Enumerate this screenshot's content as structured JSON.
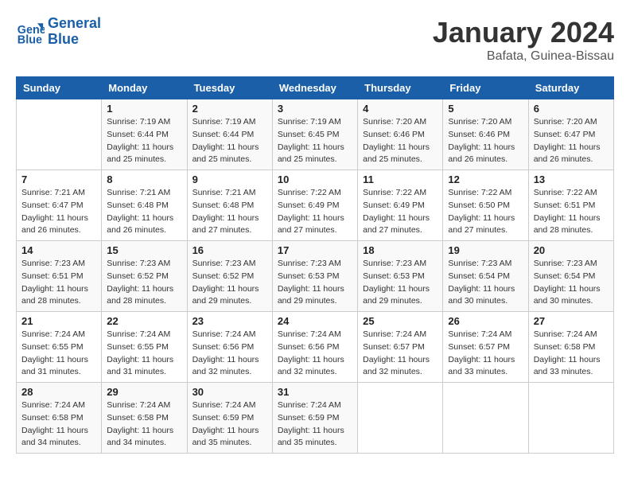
{
  "header": {
    "logo_line1": "General",
    "logo_line2": "Blue",
    "month": "January 2024",
    "location": "Bafata, Guinea-Bissau"
  },
  "weekdays": [
    "Sunday",
    "Monday",
    "Tuesday",
    "Wednesday",
    "Thursday",
    "Friday",
    "Saturday"
  ],
  "weeks": [
    [
      {
        "day": "",
        "detail": ""
      },
      {
        "day": "1",
        "detail": "Sunrise: 7:19 AM\nSunset: 6:44 PM\nDaylight: 11 hours\nand 25 minutes."
      },
      {
        "day": "2",
        "detail": "Sunrise: 7:19 AM\nSunset: 6:44 PM\nDaylight: 11 hours\nand 25 minutes."
      },
      {
        "day": "3",
        "detail": "Sunrise: 7:19 AM\nSunset: 6:45 PM\nDaylight: 11 hours\nand 25 minutes."
      },
      {
        "day": "4",
        "detail": "Sunrise: 7:20 AM\nSunset: 6:46 PM\nDaylight: 11 hours\nand 25 minutes."
      },
      {
        "day": "5",
        "detail": "Sunrise: 7:20 AM\nSunset: 6:46 PM\nDaylight: 11 hours\nand 26 minutes."
      },
      {
        "day": "6",
        "detail": "Sunrise: 7:20 AM\nSunset: 6:47 PM\nDaylight: 11 hours\nand 26 minutes."
      }
    ],
    [
      {
        "day": "7",
        "detail": "Sunrise: 7:21 AM\nSunset: 6:47 PM\nDaylight: 11 hours\nand 26 minutes."
      },
      {
        "day": "8",
        "detail": "Sunrise: 7:21 AM\nSunset: 6:48 PM\nDaylight: 11 hours\nand 26 minutes."
      },
      {
        "day": "9",
        "detail": "Sunrise: 7:21 AM\nSunset: 6:48 PM\nDaylight: 11 hours\nand 27 minutes."
      },
      {
        "day": "10",
        "detail": "Sunrise: 7:22 AM\nSunset: 6:49 PM\nDaylight: 11 hours\nand 27 minutes."
      },
      {
        "day": "11",
        "detail": "Sunrise: 7:22 AM\nSunset: 6:49 PM\nDaylight: 11 hours\nand 27 minutes."
      },
      {
        "day": "12",
        "detail": "Sunrise: 7:22 AM\nSunset: 6:50 PM\nDaylight: 11 hours\nand 27 minutes."
      },
      {
        "day": "13",
        "detail": "Sunrise: 7:22 AM\nSunset: 6:51 PM\nDaylight: 11 hours\nand 28 minutes."
      }
    ],
    [
      {
        "day": "14",
        "detail": "Sunrise: 7:23 AM\nSunset: 6:51 PM\nDaylight: 11 hours\nand 28 minutes."
      },
      {
        "day": "15",
        "detail": "Sunrise: 7:23 AM\nSunset: 6:52 PM\nDaylight: 11 hours\nand 28 minutes."
      },
      {
        "day": "16",
        "detail": "Sunrise: 7:23 AM\nSunset: 6:52 PM\nDaylight: 11 hours\nand 29 minutes."
      },
      {
        "day": "17",
        "detail": "Sunrise: 7:23 AM\nSunset: 6:53 PM\nDaylight: 11 hours\nand 29 minutes."
      },
      {
        "day": "18",
        "detail": "Sunrise: 7:23 AM\nSunset: 6:53 PM\nDaylight: 11 hours\nand 29 minutes."
      },
      {
        "day": "19",
        "detail": "Sunrise: 7:23 AM\nSunset: 6:54 PM\nDaylight: 11 hours\nand 30 minutes."
      },
      {
        "day": "20",
        "detail": "Sunrise: 7:23 AM\nSunset: 6:54 PM\nDaylight: 11 hours\nand 30 minutes."
      }
    ],
    [
      {
        "day": "21",
        "detail": "Sunrise: 7:24 AM\nSunset: 6:55 PM\nDaylight: 11 hours\nand 31 minutes."
      },
      {
        "day": "22",
        "detail": "Sunrise: 7:24 AM\nSunset: 6:55 PM\nDaylight: 11 hours\nand 31 minutes."
      },
      {
        "day": "23",
        "detail": "Sunrise: 7:24 AM\nSunset: 6:56 PM\nDaylight: 11 hours\nand 32 minutes."
      },
      {
        "day": "24",
        "detail": "Sunrise: 7:24 AM\nSunset: 6:56 PM\nDaylight: 11 hours\nand 32 minutes."
      },
      {
        "day": "25",
        "detail": "Sunrise: 7:24 AM\nSunset: 6:57 PM\nDaylight: 11 hours\nand 32 minutes."
      },
      {
        "day": "26",
        "detail": "Sunrise: 7:24 AM\nSunset: 6:57 PM\nDaylight: 11 hours\nand 33 minutes."
      },
      {
        "day": "27",
        "detail": "Sunrise: 7:24 AM\nSunset: 6:58 PM\nDaylight: 11 hours\nand 33 minutes."
      }
    ],
    [
      {
        "day": "28",
        "detail": "Sunrise: 7:24 AM\nSunset: 6:58 PM\nDaylight: 11 hours\nand 34 minutes."
      },
      {
        "day": "29",
        "detail": "Sunrise: 7:24 AM\nSunset: 6:58 PM\nDaylight: 11 hours\nand 34 minutes."
      },
      {
        "day": "30",
        "detail": "Sunrise: 7:24 AM\nSunset: 6:59 PM\nDaylight: 11 hours\nand 35 minutes."
      },
      {
        "day": "31",
        "detail": "Sunrise: 7:24 AM\nSunset: 6:59 PM\nDaylight: 11 hours\nand 35 minutes."
      },
      {
        "day": "",
        "detail": ""
      },
      {
        "day": "",
        "detail": ""
      },
      {
        "day": "",
        "detail": ""
      }
    ]
  ]
}
